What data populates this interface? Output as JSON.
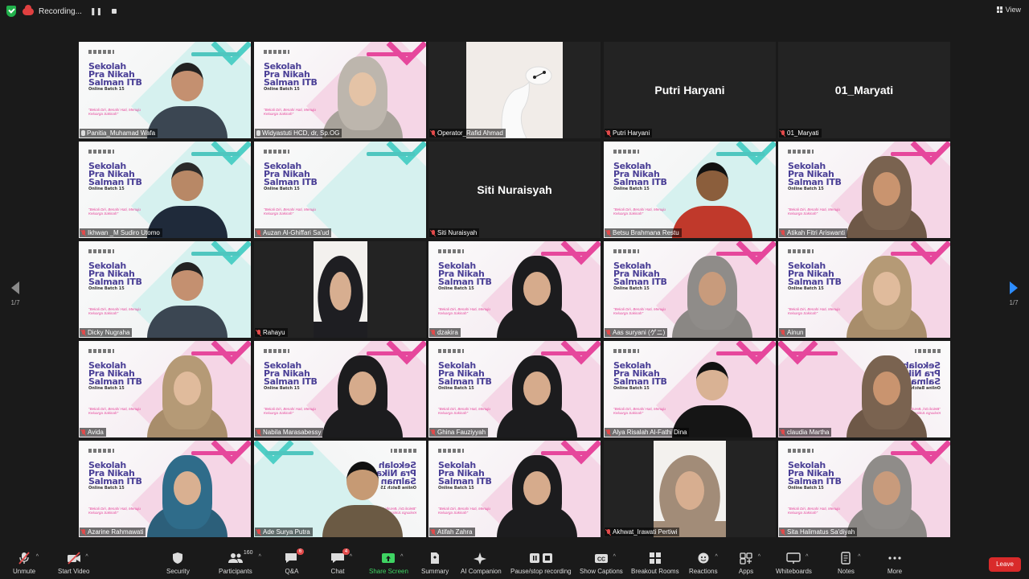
{
  "topbar": {
    "recording_label": "Recording...",
    "view_label": "View"
  },
  "pager": {
    "left": "1/7",
    "right": "1/7"
  },
  "slide": {
    "title_line1": "Sekolah",
    "title_line2": "Pra Nikah",
    "title_line3": "Salman ITB",
    "subtitle": "Online Batch 15",
    "tagline": "\"Bekali Diri, Benahi Hati, Menuju Keluarga Sakinah\""
  },
  "participants": [
    {
      "name": "Panitia_Muhamad Wafa",
      "muted": false
    },
    {
      "name": "Widyastuti HCD, dr, Sp.OG",
      "muted": false
    },
    {
      "name": "Operator_Rafid Ahmad",
      "muted": true
    },
    {
      "name": "Putri Haryani",
      "muted": true,
      "label": "Putri Haryani"
    },
    {
      "name": "01_Maryati",
      "muted": true,
      "label": "01_Maryati"
    },
    {
      "name": "Ikhwan _M Sudiro Utomo",
      "muted": true
    },
    {
      "name": "Auzan Al-Ghiffari Sa'ud",
      "muted": true
    },
    {
      "name": "Siti Nuraisyah",
      "muted": true,
      "label": "Siti Nuraisyah"
    },
    {
      "name": "Betsu Brahmana Restu",
      "muted": true
    },
    {
      "name": "Atikah Fitri Ariswanti",
      "muted": true
    },
    {
      "name": "Dicky Nugraha",
      "muted": true
    },
    {
      "name": "Rahayu",
      "muted": true
    },
    {
      "name": "dzakira",
      "muted": true
    },
    {
      "name": "Aas suryani (ゲニ)",
      "muted": true
    },
    {
      "name": "Ainun",
      "muted": true
    },
    {
      "name": "Avida",
      "muted": true
    },
    {
      "name": "Nabila Marasabessy",
      "muted": true
    },
    {
      "name": "Ghina Fauziyyah",
      "muted": true
    },
    {
      "name": "Alya Risalah Al-Fathi Dina",
      "muted": true
    },
    {
      "name": "claudia Martha",
      "muted": true
    },
    {
      "name": "Azarine Rahmawati",
      "muted": true
    },
    {
      "name": "Ade Surya Putra",
      "muted": true
    },
    {
      "name": "Atifah Zahra",
      "muted": true
    },
    {
      "name": "Akhwat_Irawati Pertiwi",
      "muted": true
    },
    {
      "name": "Sita Halimatus Sa'diyah",
      "muted": true
    }
  ],
  "toolbar": {
    "unmute": "Unmute",
    "start_video": "Start Video",
    "security": "Security",
    "participants": "Participants",
    "participants_count": "160",
    "qa": "Q&A",
    "qa_badge": "6",
    "chat": "Chat",
    "chat_badge": "4",
    "share_screen": "Share Screen",
    "summary": "Summary",
    "ai_companion": "AI Companion",
    "pause_recording": "Pause/stop recording",
    "show_captions": "Show Captions",
    "breakout_rooms": "Breakout Rooms",
    "reactions": "Reactions",
    "apps": "Apps",
    "whiteboards": "Whiteboards",
    "notes": "Notes",
    "more": "More",
    "leave": "Leave"
  },
  "colors": {
    "active_speaker": "#c6f34e",
    "share_green": "#3fd463",
    "leave_red": "#d92a2a",
    "slide_pink": "#e6479c",
    "slide_teal": "#4fcfc6",
    "slide_purple": "#4a3f96"
  }
}
